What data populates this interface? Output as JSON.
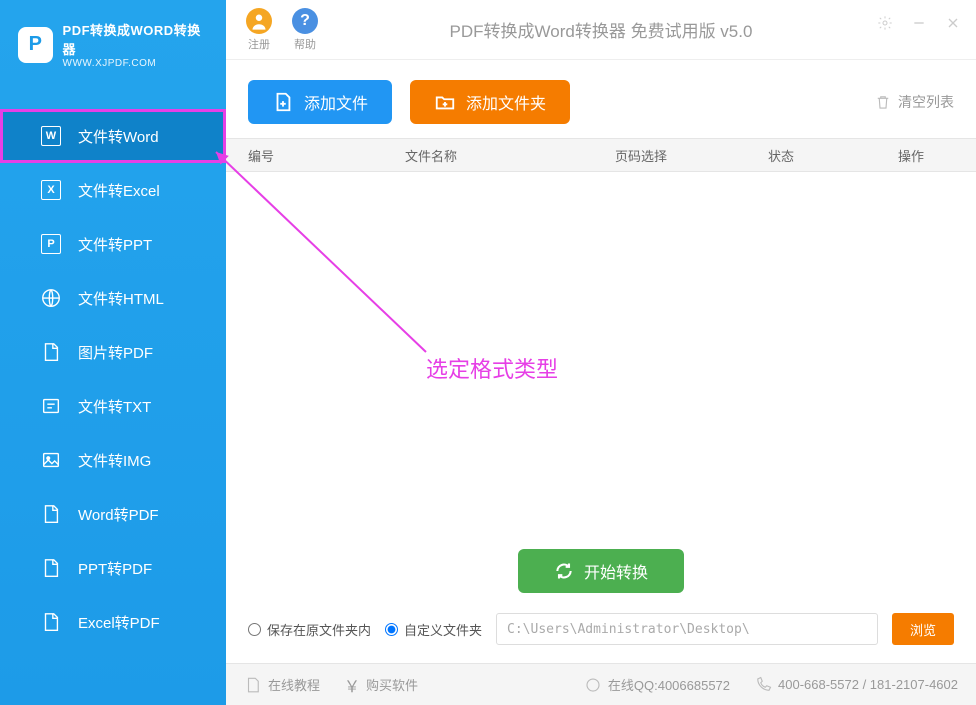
{
  "logo": {
    "title": "PDF转换成WORD转换器",
    "subtitle": "WWW.XJPDF.COM"
  },
  "nav": {
    "items": [
      {
        "label": "文件转Word",
        "icon": "W"
      },
      {
        "label": "文件转Excel",
        "icon": "X"
      },
      {
        "label": "文件转PPT",
        "icon": "P"
      },
      {
        "label": "文件转HTML",
        "icon": "globe"
      },
      {
        "label": "图片转PDF",
        "icon": "pdf"
      },
      {
        "label": "文件转TXT",
        "icon": "txt"
      },
      {
        "label": "文件转IMG",
        "icon": "img"
      },
      {
        "label": "Word转PDF",
        "icon": "pdf"
      },
      {
        "label": "PPT转PDF",
        "icon": "pdf"
      },
      {
        "label": "Excel转PDF",
        "icon": "pdf"
      }
    ]
  },
  "titlebar": {
    "register": "注册",
    "help": "帮助",
    "app_title": "PDF转换成Word转换器 免费试用版 v5.0"
  },
  "toolbar": {
    "add_file": "添加文件",
    "add_folder": "添加文件夹",
    "clear_list": "清空列表"
  },
  "table": {
    "headers": {
      "num": "编号",
      "name": "文件名称",
      "page": "页码选择",
      "status": "状态",
      "action": "操作"
    }
  },
  "annotation": "选定格式类型",
  "convert": "开始转换",
  "save": {
    "same_folder": "保存在原文件夹内",
    "custom_folder": "自定义文件夹",
    "path": "C:\\Users\\Administrator\\Desktop\\",
    "browse": "浏览"
  },
  "statusbar": {
    "tutorial": "在线教程",
    "purchase": "购买软件",
    "qq": "在线QQ:4006685572",
    "phone": "400-668-5572 / 181-2107-4602"
  }
}
